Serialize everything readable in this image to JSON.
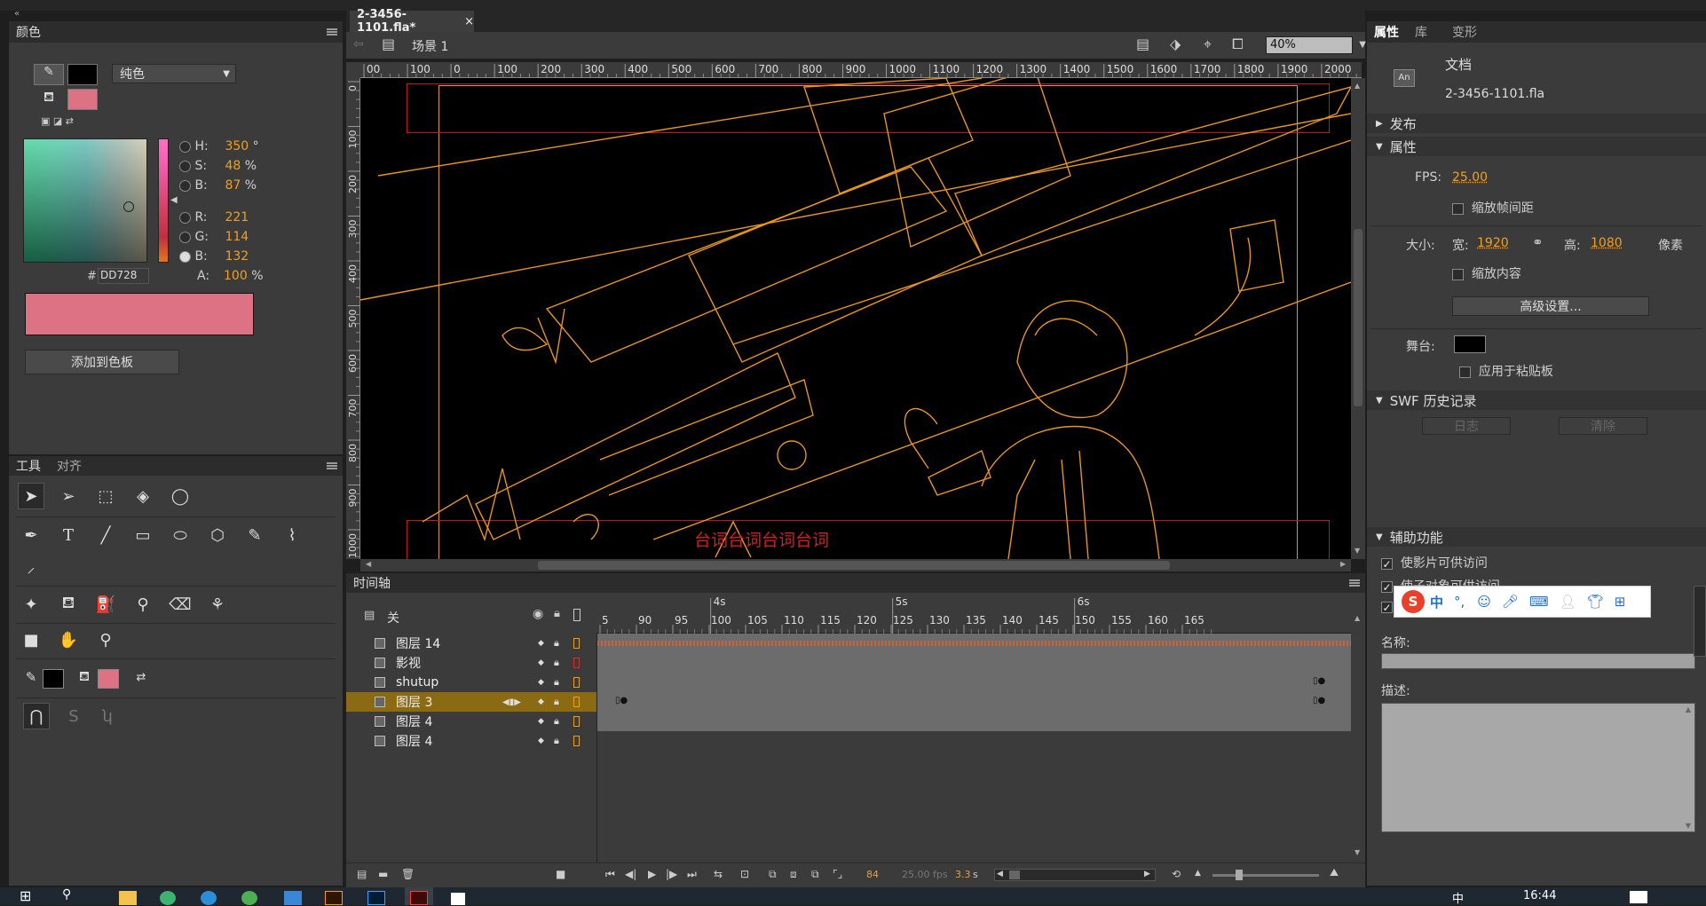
{
  "document": {
    "tab_title": "2-3456-1101.fla*",
    "tab_close": "×",
    "scene_label": "场景 1",
    "zoom": "40%"
  },
  "color_panel": {
    "title": "颜色",
    "fill_type": "纯色",
    "hsb": {
      "h_label": "H:",
      "h": "350",
      "h_unit": "°",
      "s_label": "S:",
      "s": "48",
      "s_unit": "%",
      "b_label": "B:",
      "b": "87",
      "b_unit": "%"
    },
    "rgb": {
      "r_label": "R:",
      "r": "221",
      "g_label": "G:",
      "g": "114",
      "b_label": "B:",
      "b": "132"
    },
    "alpha": {
      "label": "A:",
      "value": "100",
      "unit": "%"
    },
    "hex_prefix": "#",
    "hex": "DD728",
    "add_swatch_button": "添加到色板",
    "current_color": "#dd7284",
    "stroke_color": "#000000"
  },
  "tools_panel": {
    "tab_tools": "工具",
    "tab_align": "对齐"
  },
  "ruler": {
    "h_ticks": [
      "00",
      "100",
      "0",
      "100",
      "200",
      "300",
      "400",
      "500",
      "600",
      "700",
      "800",
      "900",
      "1000",
      "1100",
      "1200",
      "1300",
      "1400",
      "1500",
      "1600",
      "1700",
      "1800",
      "1900",
      "2000"
    ],
    "v_ticks": [
      "0",
      "100",
      "200",
      "300",
      "400",
      "500",
      "600",
      "700",
      "800",
      "900",
      "1000"
    ]
  },
  "stage": {
    "subtitle_text": "台词台词台词台词",
    "stroke_color": "#e8951e"
  },
  "timeline": {
    "title": "时间轴",
    "layer_header": "关",
    "seconds": [
      "4s",
      "5s",
      "6s"
    ],
    "frames": [
      "5",
      "90",
      "95",
      "100",
      "105",
      "110",
      "115",
      "120",
      "125",
      "130",
      "135",
      "140",
      "145",
      "150",
      "155",
      "160",
      "165"
    ],
    "layers": [
      {
        "name": "图层 14",
        "selected": false
      },
      {
        "name": "影视",
        "selected": false
      },
      {
        "name": "shutup",
        "selected": false
      },
      {
        "name": "图层 3",
        "selected": true
      },
      {
        "name": "图层 4",
        "selected": false
      },
      {
        "name": "图层 4",
        "selected": false
      }
    ],
    "status": {
      "frame": "84",
      "fps": "25.00 fps",
      "time": "3.3",
      "time_unit": "s"
    }
  },
  "properties_panel": {
    "tab_properties": "属性",
    "tab_library": "库",
    "tab_transform": "变形",
    "doc_type": "文档",
    "doc_icon": "An",
    "file_name": "2-3456-1101.fla",
    "section_publish": "发布",
    "section_properties": "属性",
    "fps_label": "FPS:",
    "fps_value": "25.00",
    "scale_spans": "缩放帧间距",
    "size_label": "大小:",
    "width_label": "宽:",
    "width_value": "1920",
    "height_label": "高:",
    "height_value": "1080",
    "pixels_label": "像素",
    "scale_content": "缩放内容",
    "advanced_button": "高级设置...",
    "stage_label": "舞台:",
    "stage_color": "#000000",
    "apply_pasteboard": "应用于粘贴板",
    "section_swf_history": "SWF 历史记录",
    "log_button": "日志",
    "clear_button": "清除",
    "section_accessibility": "辅助功能",
    "make_movie_accessible": "使影片可供访问",
    "make_objects_accessible": "使子对象可供访问",
    "name_label": "名称:",
    "description_label": "描述:"
  },
  "ime_toolbar": {
    "logo": "S",
    "lang": "中",
    "punct": "°,"
  },
  "taskbar": {
    "clock": "16:44",
    "ime_indicator": "中"
  }
}
